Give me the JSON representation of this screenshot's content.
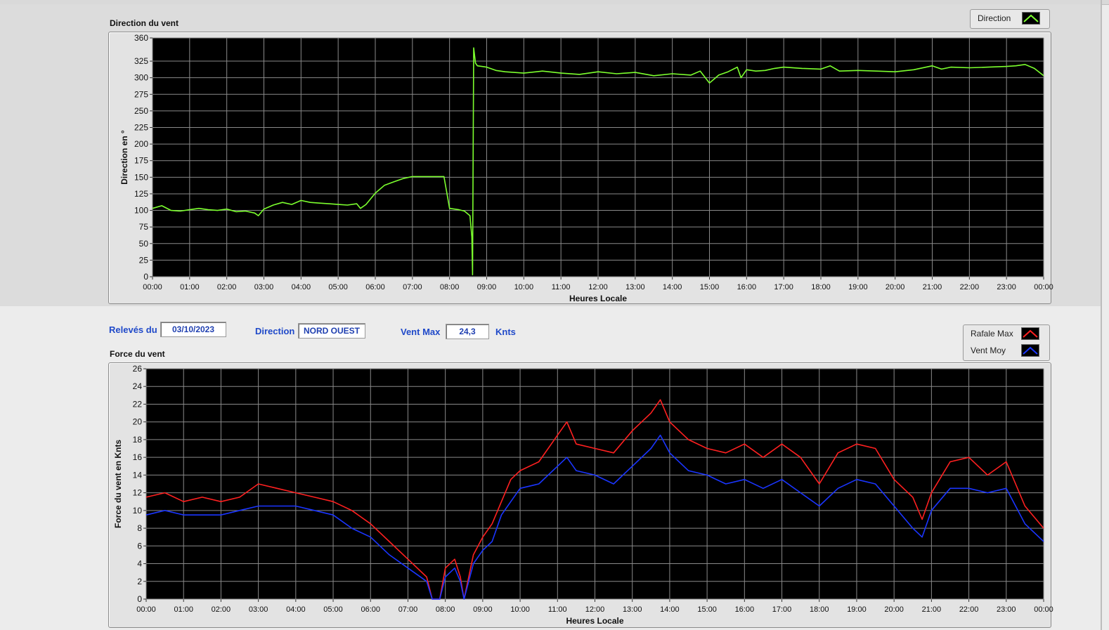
{
  "colors": {
    "direction": "#7cff2e",
    "rafale": "#ff2020",
    "vent_moy": "#1a35ff",
    "plot_bg": "#000000",
    "grid": "#8a8a8a",
    "label_blue": "#1f49c9"
  },
  "info": {
    "releves_label": "Relevés du",
    "date": "03/10/2023",
    "direction_label": "Direction",
    "direction_value": "NORD OUEST",
    "ventmax_label": "Vent Max",
    "ventmax_value": "24,3",
    "unit": "Knts"
  },
  "chart_data": [
    {
      "type": "line",
      "title": "Direction du vent",
      "xlabel": "Heures Locale",
      "ylabel": "Direction en °",
      "xlim": [
        0,
        24
      ],
      "ylim": [
        0,
        360
      ],
      "yticks": [
        "0",
        "25",
        "50",
        "75",
        "100",
        "125",
        "150",
        "175",
        "200",
        "225",
        "250",
        "275",
        "300",
        "325",
        "360"
      ],
      "xticks": [
        "00:00",
        "01:00",
        "02:00",
        "03:00",
        "04:00",
        "05:00",
        "06:00",
        "07:00",
        "08:00",
        "09:00",
        "10:00",
        "11:00",
        "12:00",
        "13:00",
        "14:00",
        "15:00",
        "16:00",
        "17:00",
        "18:00",
        "19:00",
        "20:00",
        "21:00",
        "22:00",
        "23:00",
        "00:00"
      ],
      "grid": true,
      "legend_position": "top-right",
      "series": [
        {
          "name": "Direction",
          "color": "#7cff2e",
          "x": [
            0.0,
            0.25,
            0.5,
            0.75,
            1.0,
            1.25,
            1.5,
            1.75,
            2.0,
            2.25,
            2.5,
            2.75,
            2.85,
            3.0,
            3.25,
            3.5,
            3.75,
            4.0,
            4.25,
            4.5,
            4.75,
            5.0,
            5.25,
            5.5,
            5.6,
            5.75,
            6.0,
            6.25,
            6.5,
            6.75,
            7.0,
            7.25,
            7.5,
            7.75,
            7.85,
            8.0,
            8.25,
            8.4,
            8.55,
            8.6,
            8.62,
            8.65,
            8.7,
            8.75,
            9.0,
            9.25,
            9.5,
            10.0,
            10.5,
            11.0,
            11.5,
            12.0,
            12.5,
            13.0,
            13.5,
            14.0,
            14.5,
            14.75,
            15.0,
            15.25,
            15.5,
            15.75,
            15.85,
            16.0,
            16.25,
            16.5,
            16.75,
            17.0,
            17.5,
            18.0,
            18.25,
            18.5,
            19.0,
            19.5,
            20.0,
            20.5,
            21.0,
            21.25,
            21.5,
            22.0,
            22.5,
            23.0,
            23.25,
            23.5,
            23.75,
            24.0
          ],
          "y": [
            103,
            107,
            100,
            99,
            101,
            103,
            101,
            100,
            102,
            98,
            99,
            96,
            92,
            102,
            108,
            112,
            109,
            115,
            112,
            111,
            110,
            109,
            108,
            110,
            103,
            109,
            126,
            138,
            143,
            148,
            151,
            151,
            151,
            151,
            151,
            103,
            101,
            99,
            92,
            60,
            3,
            345,
            322,
            318,
            316,
            311,
            309,
            307,
            310,
            307,
            305,
            309,
            306,
            308,
            303,
            306,
            304,
            310,
            292,
            304,
            309,
            316,
            300,
            312,
            310,
            311,
            314,
            316,
            314,
            313,
            318,
            310,
            311,
            310,
            309,
            312,
            318,
            313,
            316,
            315,
            316,
            317,
            318,
            320,
            314,
            303
          ]
        }
      ]
    },
    {
      "type": "line",
      "title": "Force du vent",
      "xlabel": "Heures Locale",
      "ylabel": "Force du vent en Knts",
      "xlim": [
        0,
        24
      ],
      "ylim": [
        0,
        26
      ],
      "yticks": [
        "0",
        "2",
        "4",
        "6",
        "8",
        "10",
        "12",
        "14",
        "16",
        "18",
        "20",
        "22",
        "24",
        "26"
      ],
      "xticks": [
        "00:00",
        "01:00",
        "02:00",
        "03:00",
        "04:00",
        "05:00",
        "06:00",
        "07:00",
        "08:00",
        "09:00",
        "10:00",
        "11:00",
        "12:00",
        "13:00",
        "14:00",
        "15:00",
        "16:00",
        "17:00",
        "18:00",
        "19:00",
        "20:00",
        "21:00",
        "22:00",
        "23:00",
        "00:00"
      ],
      "grid": true,
      "legend_position": "top-right",
      "series": [
        {
          "name": "Rafale Max",
          "color": "#ff2020",
          "x": [
            0.0,
            0.5,
            1.0,
            1.5,
            2.0,
            2.5,
            3.0,
            3.5,
            4.0,
            4.5,
            5.0,
            5.5,
            6.0,
            6.5,
            7.0,
            7.5,
            7.65,
            7.85,
            8.0,
            8.25,
            8.4,
            8.5,
            8.75,
            9.0,
            9.25,
            9.5,
            9.75,
            10.0,
            10.5,
            11.0,
            11.25,
            11.5,
            12.0,
            12.5,
            13.0,
            13.5,
            13.75,
            14.0,
            14.5,
            15.0,
            15.5,
            16.0,
            16.5,
            17.0,
            17.5,
            18.0,
            18.5,
            19.0,
            19.5,
            20.0,
            20.5,
            20.75,
            21.0,
            21.5,
            22.0,
            22.5,
            23.0,
            23.5,
            24.0
          ],
          "y": [
            11.5,
            12.0,
            11.0,
            11.5,
            11.0,
            11.5,
            13.0,
            12.5,
            12.0,
            11.5,
            11.0,
            10.0,
            8.5,
            6.5,
            4.5,
            2.5,
            0,
            0,
            3.5,
            4.5,
            2.5,
            0,
            5.0,
            7.0,
            8.5,
            11.0,
            13.5,
            14.5,
            15.5,
            18.5,
            20.0,
            17.5,
            17.0,
            16.5,
            19.0,
            21.0,
            22.5,
            20.0,
            18.0,
            17.0,
            16.5,
            17.5,
            16.0,
            17.5,
            16.0,
            13.0,
            16.5,
            17.5,
            17.0,
            13.5,
            11.5,
            9.0,
            12.0,
            15.5,
            16.0,
            14.0,
            15.5,
            10.5,
            8.0
          ]
        },
        {
          "name": "Vent Moy",
          "color": "#1a35ff",
          "x": [
            0.0,
            0.5,
            1.0,
            1.5,
            2.0,
            2.5,
            3.0,
            3.5,
            4.0,
            4.5,
            5.0,
            5.5,
            6.0,
            6.5,
            7.0,
            7.5,
            7.65,
            7.85,
            8.0,
            8.25,
            8.4,
            8.5,
            8.75,
            9.0,
            9.25,
            9.5,
            9.75,
            10.0,
            10.5,
            11.0,
            11.25,
            11.5,
            12.0,
            12.5,
            13.0,
            13.5,
            13.75,
            14.0,
            14.5,
            15.0,
            15.5,
            16.0,
            16.5,
            17.0,
            17.5,
            18.0,
            18.5,
            19.0,
            19.5,
            20.0,
            20.5,
            20.75,
            21.0,
            21.5,
            22.0,
            22.5,
            23.0,
            23.5,
            24.0
          ],
          "y": [
            9.5,
            10.0,
            9.5,
            9.5,
            9.5,
            10.0,
            10.5,
            10.5,
            10.5,
            10.0,
            9.5,
            8.0,
            7.0,
            5.0,
            3.5,
            2.0,
            0,
            0,
            2.5,
            3.5,
            2.0,
            0,
            4.0,
            5.5,
            6.5,
            9.5,
            11.0,
            12.5,
            13.0,
            15.0,
            16.0,
            14.5,
            14.0,
            13.0,
            15.0,
            17.0,
            18.5,
            16.5,
            14.5,
            14.0,
            13.0,
            13.5,
            12.5,
            13.5,
            12.0,
            10.5,
            12.5,
            13.5,
            13.0,
            10.5,
            8.0,
            7.0,
            10.0,
            12.5,
            12.5,
            12.0,
            12.5,
            8.5,
            6.5
          ]
        }
      ]
    }
  ]
}
